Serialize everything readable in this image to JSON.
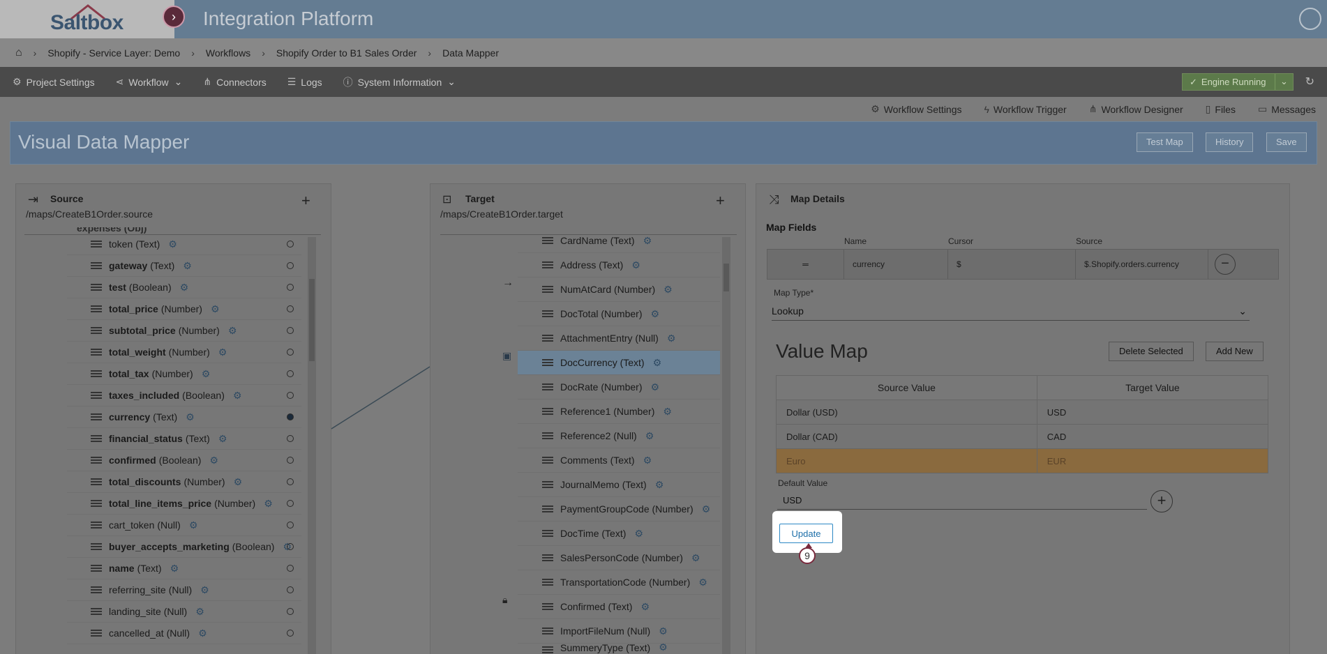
{
  "app": {
    "logo": "Saltbox",
    "title": "Integration Platform"
  },
  "breadcrumb": [
    "Shopify - Service Layer: Demo",
    "Workflows",
    "Shopify Order to B1 Sales Order",
    "Data Mapper"
  ],
  "nav": [
    {
      "label": "Project Settings",
      "icon": "settings-icon"
    },
    {
      "label": "Workflow",
      "icon": "share-icon"
    },
    {
      "label": "Connectors",
      "icon": "network-icon"
    },
    {
      "label": "Logs",
      "icon": "database-icon"
    },
    {
      "label": "System Information",
      "icon": "info-icon"
    }
  ],
  "engine": {
    "label": "Engine Running"
  },
  "subnav": [
    "Workflow Settings",
    "Workflow Trigger",
    "Workflow Designer",
    "Files",
    "Messages"
  ],
  "header": {
    "title": "Visual Data Mapper",
    "buttons": {
      "test_map": "Test Map",
      "history": "History",
      "save": "Save"
    }
  },
  "source": {
    "title": "Source",
    "path": "/maps/CreateB1Order.source",
    "partial_top": "expenses (Obj)",
    "rows": [
      {
        "name": "token",
        "type": "(Text)",
        "bold": false
      },
      {
        "name": "gateway",
        "type": "(Text)",
        "bold": true
      },
      {
        "name": "test",
        "type": "(Boolean)",
        "bold": true
      },
      {
        "name": "total_price",
        "type": "(Number)",
        "bold": true
      },
      {
        "name": "subtotal_price",
        "type": "(Number)",
        "bold": true
      },
      {
        "name": "total_weight",
        "type": "(Number)",
        "bold": true
      },
      {
        "name": "total_tax",
        "type": "(Number)",
        "bold": true
      },
      {
        "name": "taxes_included",
        "type": "(Boolean)",
        "bold": true
      },
      {
        "name": "currency",
        "type": "(Text)",
        "bold": true
      },
      {
        "name": "financial_status",
        "type": "(Text)",
        "bold": true
      },
      {
        "name": "confirmed",
        "type": "(Boolean)",
        "bold": true
      },
      {
        "name": "total_discounts",
        "type": "(Number)",
        "bold": true
      },
      {
        "name": "total_line_items_price",
        "type": "(Number)",
        "bold": true
      },
      {
        "name": "cart_token",
        "type": "(Null)",
        "bold": false
      },
      {
        "name": "buyer_accepts_marketing",
        "type": "(Boolean)",
        "bold": true
      },
      {
        "name": "name",
        "type": "(Text)",
        "bold": true
      },
      {
        "name": "referring_site",
        "type": "(Null)",
        "bold": false
      },
      {
        "name": "landing_site",
        "type": "(Null)",
        "bold": false
      },
      {
        "name": "cancelled_at",
        "type": "(Null)",
        "bold": false
      }
    ]
  },
  "target": {
    "title": "Target",
    "path": "/maps/CreateB1Order.target",
    "rows": [
      "CardName (Text)",
      "Address (Text)",
      "NumAtCard (Number)",
      "DocTotal (Number)",
      "AttachmentEntry (Null)",
      "DocCurrency (Text)",
      "DocRate (Number)",
      "Reference1 (Number)",
      "Reference2 (Null)",
      "Comments (Text)",
      "JournalMemo (Text)",
      "PaymentGroupCode (Number)",
      "DocTime (Text)",
      "SalesPersonCode (Number)",
      "TransportationCode (Number)",
      "Confirmed (Text)",
      "ImportFileNum (Null)",
      "SummeryType (Text)"
    ]
  },
  "map_details": {
    "title": "Map Details",
    "fields_label": "Map Fields",
    "columns": {
      "name": "Name",
      "cursor": "Cursor",
      "source": "Source"
    },
    "field": {
      "name": "currency",
      "cursor": "$",
      "source": "$.Shopify.orders.currency"
    },
    "map_type_label": "Map Type*",
    "map_type_value": "Lookup",
    "value_map_title": "Value Map",
    "delete_selected": "Delete Selected",
    "add_new": "Add New",
    "table_headers": [
      "Source Value",
      "Target Value"
    ],
    "table_rows": [
      {
        "source": "Dollar (USD)",
        "target": "USD"
      },
      {
        "source": "Dollar (CAD)",
        "target": "CAD"
      },
      {
        "source": "Euro",
        "target": "EUR"
      }
    ],
    "default_value_label": "Default Value",
    "default_value": "USD",
    "update_label": "Update",
    "step_number": "9"
  }
}
